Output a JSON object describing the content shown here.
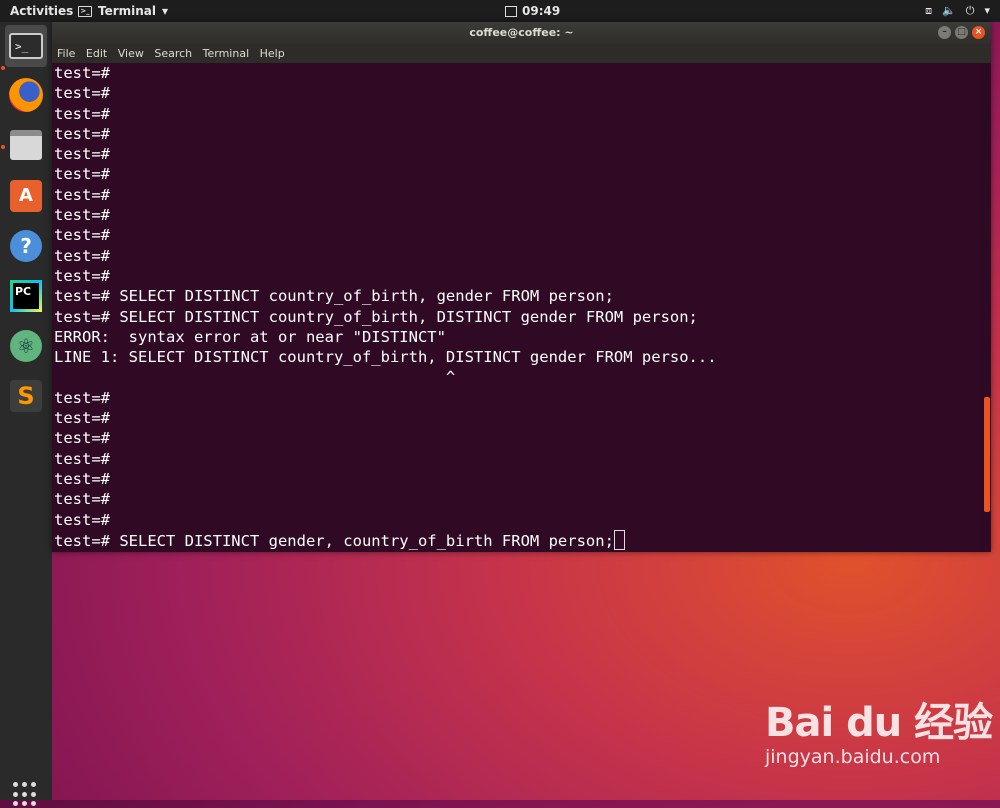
{
  "topbar": {
    "activities": "Activities",
    "app_name": "Terminal",
    "clock": "09:49",
    "status_icons": [
      "network-icon",
      "volume-icon",
      "power-icon"
    ]
  },
  "dock": {
    "apps": [
      "terminal-icon",
      "firefox-icon",
      "files-icon",
      "software-center-icon",
      "help-icon",
      "pycharm-icon",
      "atom-icon",
      "sublime-text-icon"
    ],
    "show_apps": "show-applications-icon"
  },
  "window": {
    "title": "coffee@coffee: ~",
    "menu": [
      "File",
      "Edit",
      "View",
      "Search",
      "Terminal",
      "Help"
    ],
    "accent_color": "#e95420",
    "background_color": "#300a24"
  },
  "terminal": {
    "lines": [
      "test=#",
      "test=#",
      "test=#",
      "test=#",
      "test=#",
      "test=#",
      "test=#",
      "test=#",
      "test=#",
      "test=#",
      "test=#",
      "test=# SELECT DISTINCT country_of_birth, gender FROM person;",
      "test=# SELECT DISTINCT country_of_birth, DISTINCT gender FROM person;",
      "ERROR:  syntax error at or near \"DISTINCT\"",
      "LINE 1: SELECT DISTINCT country_of_birth, DISTINCT gender FROM perso...",
      "                                          ^",
      "test=#",
      "test=#",
      "test=#",
      "test=#",
      "test=#",
      "test=#",
      "test=#",
      "test=# SELECT DISTINCT gender, country_of_birth FROM person;"
    ]
  },
  "watermark": {
    "logo": "Bai du 经验",
    "url": "jingyan.baidu.com"
  }
}
